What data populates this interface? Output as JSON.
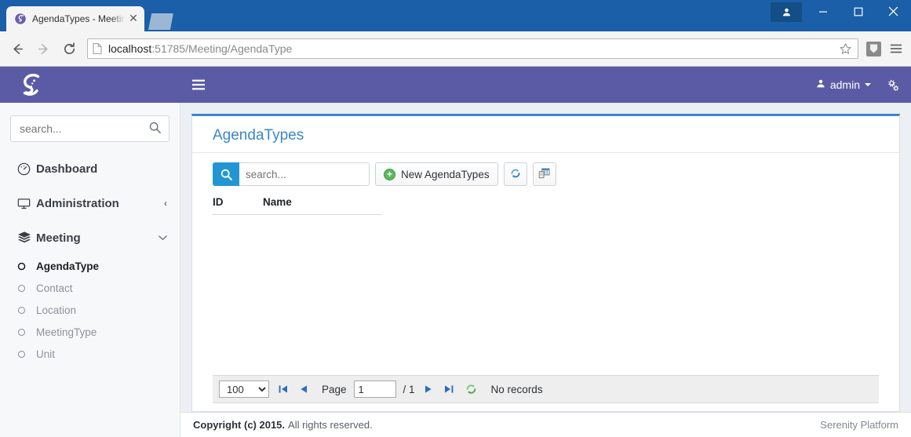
{
  "browser": {
    "tab": {
      "title": "AgendaTypes - MeetingM",
      "close_label": "✕",
      "favicon": "serenity-spiral-icon"
    },
    "newtab_label": "",
    "window": {
      "profile": "profile-icon",
      "minimize": "─",
      "maximize": "□",
      "close": "✕"
    },
    "nav": {
      "back": "←",
      "forward": "→",
      "reload": "⟳"
    },
    "address": {
      "scheme_host": "localhost",
      "rest": ":51785/Meeting/AgendaType",
      "full": "localhost:51785/Meeting/AgendaType"
    },
    "bookmark_icon": "star-icon",
    "extension_icon": "extension-icon",
    "menu_icon": "chrome-menu-icon"
  },
  "topbar": {
    "logo": "serenity-logo",
    "toggle_icon": "hamburger-icon",
    "user": "admin",
    "settings_icon": "cogs-icon"
  },
  "sidebar": {
    "search_placeholder": "search...",
    "search_value": "",
    "search_icon": "magnifier-icon",
    "items": [
      {
        "label": "Dashboard",
        "icon": "dashboard-speedometer-icon",
        "chevron": ""
      },
      {
        "label": "Administration",
        "icon": "monitor-icon",
        "chevron": "‹"
      },
      {
        "label": "Meeting",
        "icon": "layers-icon",
        "chevron": "⌄"
      }
    ],
    "sub_items": [
      {
        "label": "AgendaType",
        "icon": "circle-icon",
        "active": true
      },
      {
        "label": "Contact",
        "icon": "circle-icon",
        "active": false
      },
      {
        "label": "Location",
        "icon": "circle-icon",
        "active": false
      },
      {
        "label": "MeetingType",
        "icon": "circle-icon",
        "active": false
      },
      {
        "label": "Unit",
        "icon": "circle-icon",
        "active": false
      }
    ]
  },
  "page": {
    "title": "AgendaTypes",
    "quicksearch": {
      "placeholder": "search...",
      "value": "",
      "icon": "magnifier-icon"
    },
    "toolbar": {
      "new_label": "New AgendaTypes",
      "new_icon": "plus-circle-icon",
      "refresh_icon": "refresh-icon",
      "columns_icon": "column-picker-icon"
    },
    "grid": {
      "columns": [
        "ID",
        "Name"
      ],
      "rows": []
    },
    "pager": {
      "page_size": "100",
      "page_size_options": [
        "100"
      ],
      "first_icon": "first-page-icon",
      "prev_icon": "prev-page-icon",
      "page_label": "Page",
      "page_value": "1",
      "total_pages": "/ 1",
      "next_icon": "next-page-icon",
      "last_icon": "last-page-icon",
      "reload_icon": "reload-green-icon",
      "status": "No records"
    }
  },
  "footer": {
    "copyright_bold": "Copyright (c) 2015.",
    "copyright_rest": "All rights reserved.",
    "platform": "Serenity Platform"
  },
  "colors": {
    "brand_purple": "#5b5ba5",
    "accent_blue": "#3a87c8",
    "search_blue": "#2196d3",
    "new_green": "#5cb75c",
    "chrome_blue": "#1a5fa8"
  }
}
